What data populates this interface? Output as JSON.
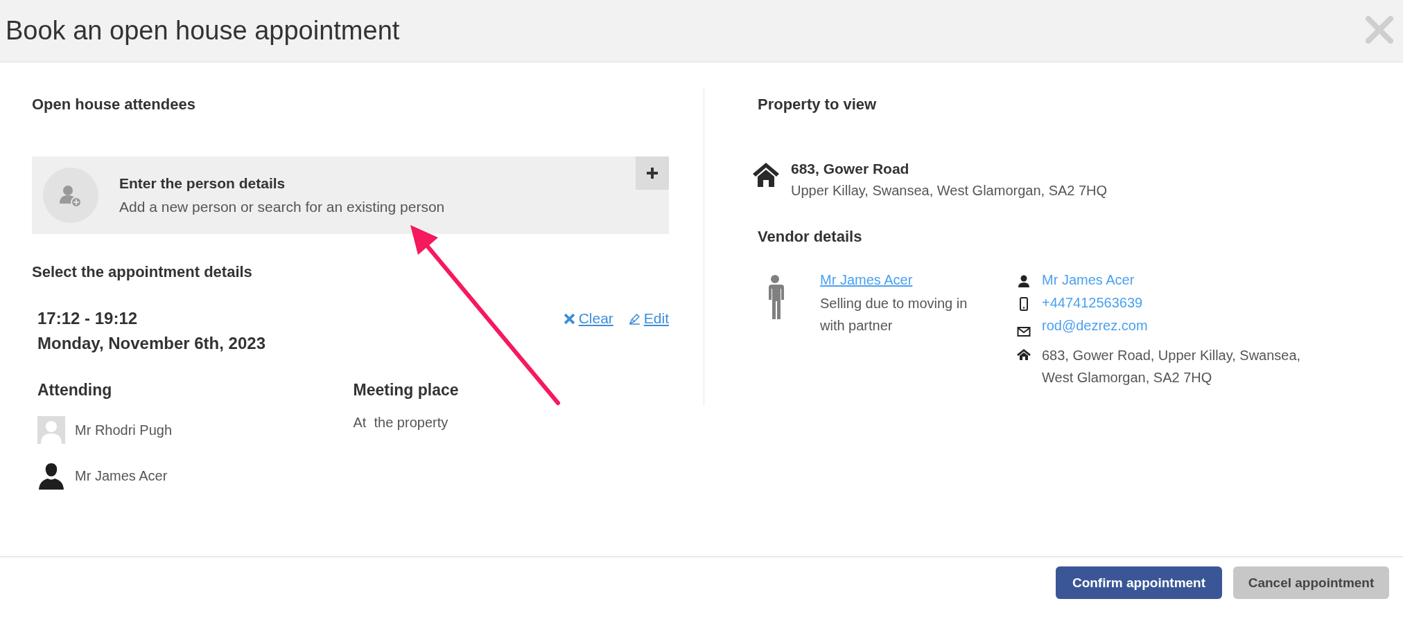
{
  "dialog": {
    "title": "Book an open house appointment"
  },
  "attendees": {
    "heading": "Open house attendees",
    "person_card": {
      "title": "Enter the person details",
      "subtitle": "Add a new person or search for an existing person"
    }
  },
  "appointment": {
    "heading": "Select the appointment details",
    "time": "17:12 - 19:12",
    "date": "Monday, November 6th, 2023",
    "actions": [
      {
        "kind": "clear",
        "label": "Clear"
      },
      {
        "kind": "edit",
        "label": "Edit"
      }
    ],
    "attending": {
      "heading": "Attending",
      "people": [
        {
          "kind": "photo",
          "name": "Mr Rhodri Pugh"
        },
        {
          "kind": "silhouette",
          "name": "Mr James Acer"
        }
      ]
    },
    "meeting": {
      "heading": "Meeting place",
      "value": "At  the property"
    }
  },
  "property": {
    "heading": "Property to view",
    "address_line_1": "683, Gower Road",
    "address_line_2": "Upper Killay, Swansea, West Glamorgan, SA2 7HQ"
  },
  "vendor": {
    "heading": "Vendor details",
    "name": "Mr James Acer",
    "note": "Selling due to moving in with partner",
    "contacts": [
      {
        "kind": "person",
        "value": "Mr James Acer"
      },
      {
        "kind": "phone",
        "value": "+447412563639"
      },
      {
        "kind": "email",
        "value": "rod@dezrez.com"
      },
      {
        "kind": "home",
        "value": "683, Gower Road, Upper Killay, Swansea, West Glamorgan, SA2 7HQ"
      }
    ]
  },
  "buttons": [
    {
      "kind": "primary",
      "label": "Confirm appointment"
    },
    {
      "kind": "secondary",
      "label": "Cancel appointment"
    }
  ]
}
